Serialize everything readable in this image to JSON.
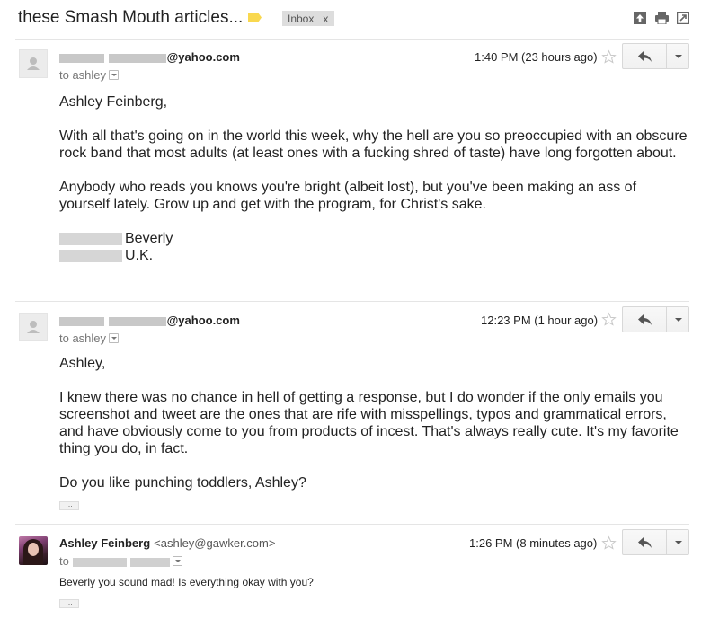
{
  "thread": {
    "subject": "these Smash Mouth articles...",
    "label_chip": "Inbox",
    "label_chip_close": "x",
    "label_color": "#f9d84f"
  },
  "toolbar_icons": [
    "archive-up-icon",
    "print-icon",
    "new-window-icon"
  ],
  "messages": [
    {
      "sender_email": "@yahoo.com",
      "to_text": "to ashley",
      "time": "1:40 PM (23 hours ago)",
      "greeting": "Ashley Feinberg,",
      "paragraphs": [
        "With all that's going on in the world this week, why the hell are you so preoccupied with an obscure rock band that most adults (at least ones with a fucking shred of taste) have long forgotten about.",
        "Anybody who reads you knows you're bright (albeit lost), but you've been making an ass of yourself lately. Grow up and get with the program, for Christ's sake."
      ],
      "signature": [
        "Beverly",
        "U.K."
      ]
    },
    {
      "sender_email": "@yahoo.com",
      "to_text": "to ashley",
      "time": "12:23 PM (1 hour ago)",
      "greeting": "Ashley,",
      "paragraphs": [
        "I knew there was no chance in hell of getting a response, but I do wonder if the only emails you screenshot and tweet are the ones that are rife with misspellings, typos and grammatical errors, and have obviously come to you from products of incest. That's always really cute. It's my favorite thing you do, in fact.",
        "Do you like punching toddlers, Ashley?"
      ],
      "trimmed_label": "..."
    },
    {
      "sender_name": "Ashley Feinberg",
      "sender_email": "<ashley@gawker.com>",
      "to_text": "to",
      "time": "1:26 PM (8 minutes ago)",
      "body": "Beverly you sound mad! Is everything okay with you?",
      "trimmed_label": "..."
    }
  ]
}
